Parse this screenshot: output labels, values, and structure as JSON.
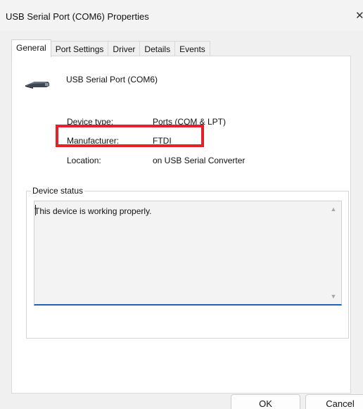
{
  "window": {
    "title": "USB Serial Port (COM6) Properties",
    "close_glyph": "✕"
  },
  "tabs": [
    {
      "label": "General",
      "active": true
    },
    {
      "label": "Port Settings",
      "active": false
    },
    {
      "label": "Driver",
      "active": false
    },
    {
      "label": "Details",
      "active": false
    },
    {
      "label": "Events",
      "active": false
    }
  ],
  "device": {
    "name": "USB Serial Port (COM6)",
    "icon": "usb-connector-icon"
  },
  "properties": {
    "device_type_label": "Device type:",
    "device_type_value": "Ports (COM & LPT)",
    "manufacturer_label": "Manufacturer:",
    "manufacturer_value": "FTDI",
    "location_label": "Location:",
    "location_value": "on USB Serial Converter"
  },
  "highlight_color": "#e51f2c",
  "status": {
    "legend": "Device status",
    "text": "This device is working properly.",
    "scroll_up_glyph": "▲",
    "scroll_down_glyph": "▼"
  },
  "buttons": {
    "ok_label": "OK",
    "cancel_label": "Cancel"
  }
}
